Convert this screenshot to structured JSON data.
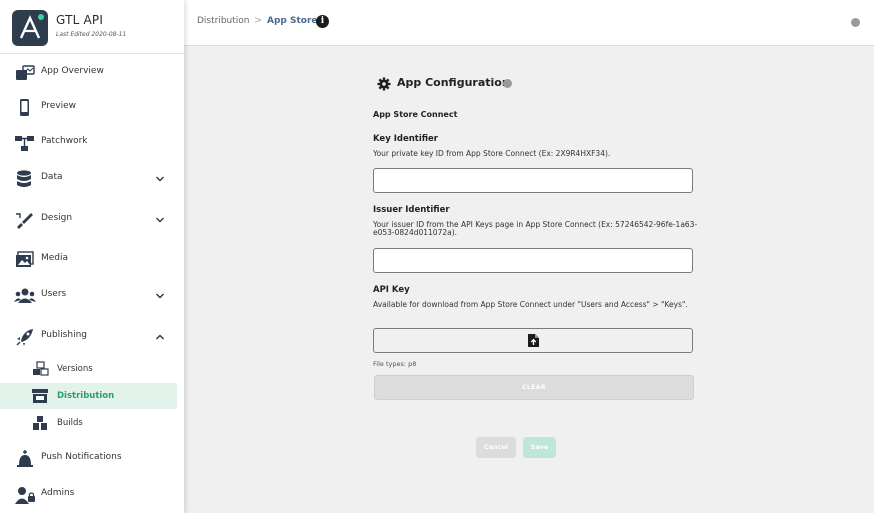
{
  "app": {
    "name": "GTL API",
    "subtitle": "Last Edited 2020-08-11",
    "accent": "#2a9d74"
  },
  "sidebar": {
    "items": [
      {
        "label": "App Overview",
        "icon": "app-overview-icon"
      },
      {
        "label": "Preview",
        "icon": "phone-icon"
      },
      {
        "label": "Patchwork",
        "icon": "patchwork-icon"
      },
      {
        "label": "Data",
        "icon": "database-icon",
        "expandable": true
      },
      {
        "label": "Design",
        "icon": "design-icon",
        "expandable": true
      },
      {
        "label": "Media",
        "icon": "image-icon"
      },
      {
        "label": "Users",
        "icon": "users-icon",
        "expandable": true
      },
      {
        "label": "Publishing",
        "icon": "rocket-icon",
        "expanded": true
      },
      {
        "label": "Push Notifications",
        "icon": "push-icon"
      },
      {
        "label": "Admins",
        "icon": "admin-icon"
      }
    ],
    "publishing_sub": [
      {
        "label": "Versions",
        "icon": "versions-icon"
      },
      {
        "label": "Distribution",
        "icon": "store-icon",
        "active": true
      },
      {
        "label": "Builds",
        "icon": "builds-icon"
      }
    ]
  },
  "header": {
    "breadcrumb": [
      "Distribution",
      "App Store"
    ],
    "separator": ">",
    "info_icon": "i"
  },
  "config": {
    "title": "App Configuration",
    "section": "App Store Connect",
    "key_identifier": {
      "label": "Key Identifier",
      "help": "Your private key ID from App Store Connect (Ex: 2X9R4HXF34).",
      "value": ""
    },
    "issuer_identifier": {
      "label": "Issuer Identifier",
      "help": "Your issuer ID from the API Keys page in App Store Connect (Ex: 57246542-96fe-1a63-e053-0824d011072a).",
      "value": ""
    },
    "api_key": {
      "label": "API Key",
      "help": "Available for download from App Store Connect under \"Users and Access\" > \"Keys\".",
      "file_types": "File types: p8",
      "clear_label": "CLEAR"
    },
    "cancel_label": "Cancel",
    "save_label": "Save"
  }
}
